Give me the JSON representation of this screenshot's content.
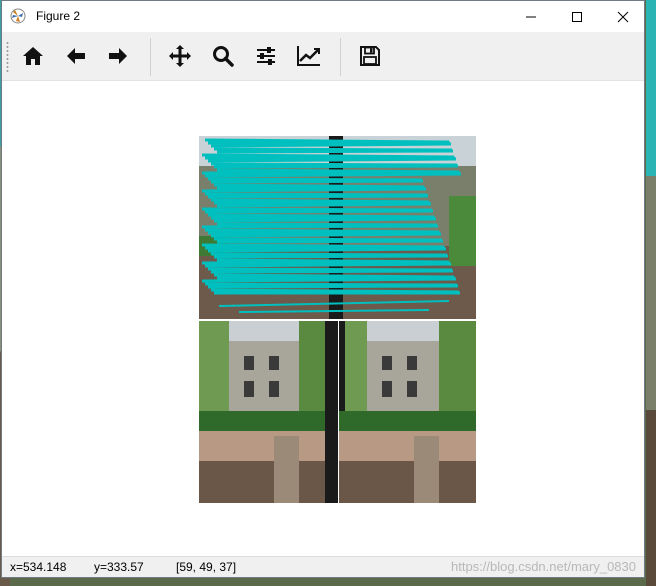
{
  "window": {
    "title": "Figure 2",
    "controls": [
      "minimize",
      "maximize",
      "close"
    ]
  },
  "toolbar": {
    "buttons": [
      {
        "name": "home",
        "icon": "home-icon"
      },
      {
        "name": "back",
        "icon": "arrow-left-icon"
      },
      {
        "name": "forward",
        "icon": "arrow-right-icon"
      },
      {
        "name": "pan",
        "icon": "move-icon"
      },
      {
        "name": "zoom",
        "icon": "magnifier-icon"
      },
      {
        "name": "subplots",
        "icon": "sliders-icon"
      },
      {
        "name": "edit-axis",
        "icon": "chart-line-icon"
      },
      {
        "name": "save",
        "icon": "floppy-disk-icon"
      }
    ]
  },
  "figure": {
    "panels": [
      {
        "position": "top-left",
        "content": "house-photo-with-cyan-scribbles",
        "scribble_color": "#00bfbf"
      },
      {
        "position": "bottom-left",
        "content": "house-photo"
      },
      {
        "position": "bottom-right",
        "content": "house-photo"
      }
    ]
  },
  "status": {
    "x": "x=534.148",
    "y": "y=333.57",
    "pixel": "[59, 49, 37]"
  },
  "watermark": "https://blog.csdn.net/mary_0830"
}
